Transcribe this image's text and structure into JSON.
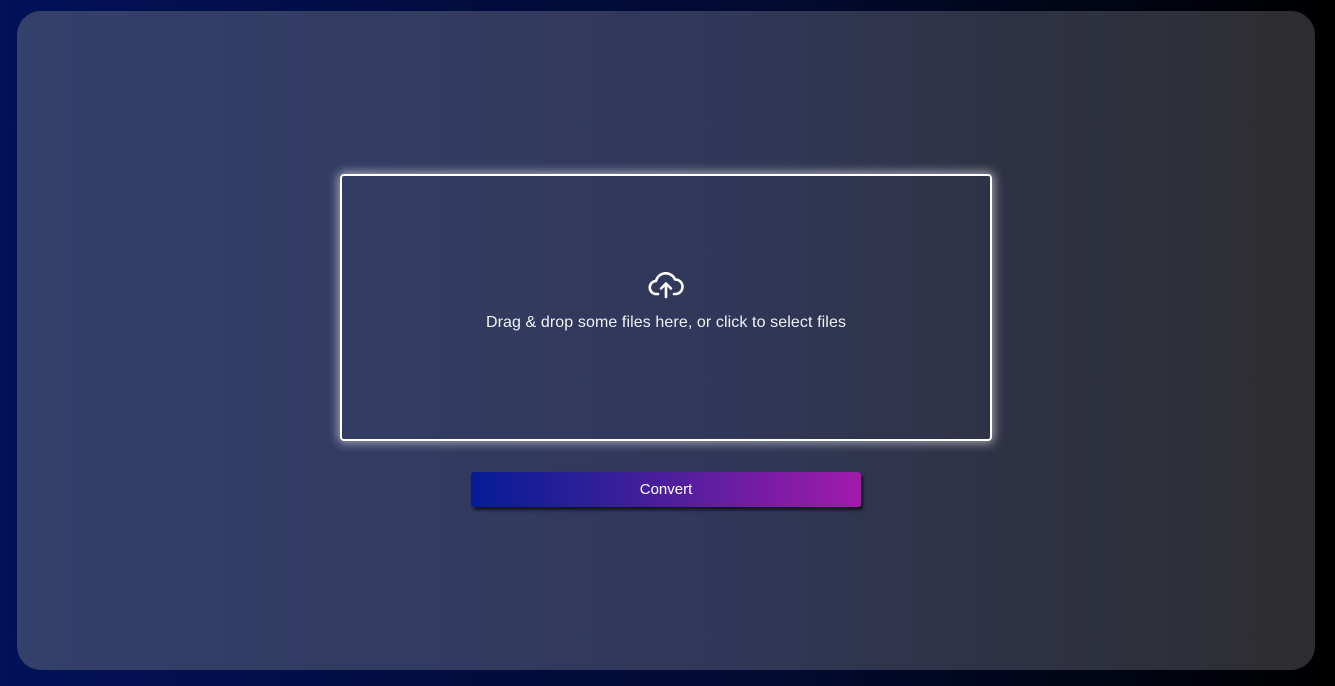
{
  "dropzone": {
    "icon": "cloud-upload-icon",
    "text": "Drag & drop some files here, or click to select files"
  },
  "actions": {
    "convert_label": "Convert"
  },
  "colors": {
    "page_background_start": "#021158",
    "page_background_end": "#000000",
    "card_background_start": "#33406b",
    "card_background_end": "#2d2d2f",
    "dropzone_border": "#ffffff",
    "button_gradient_start": "#061b96",
    "button_gradient_end": "#a21bab"
  }
}
